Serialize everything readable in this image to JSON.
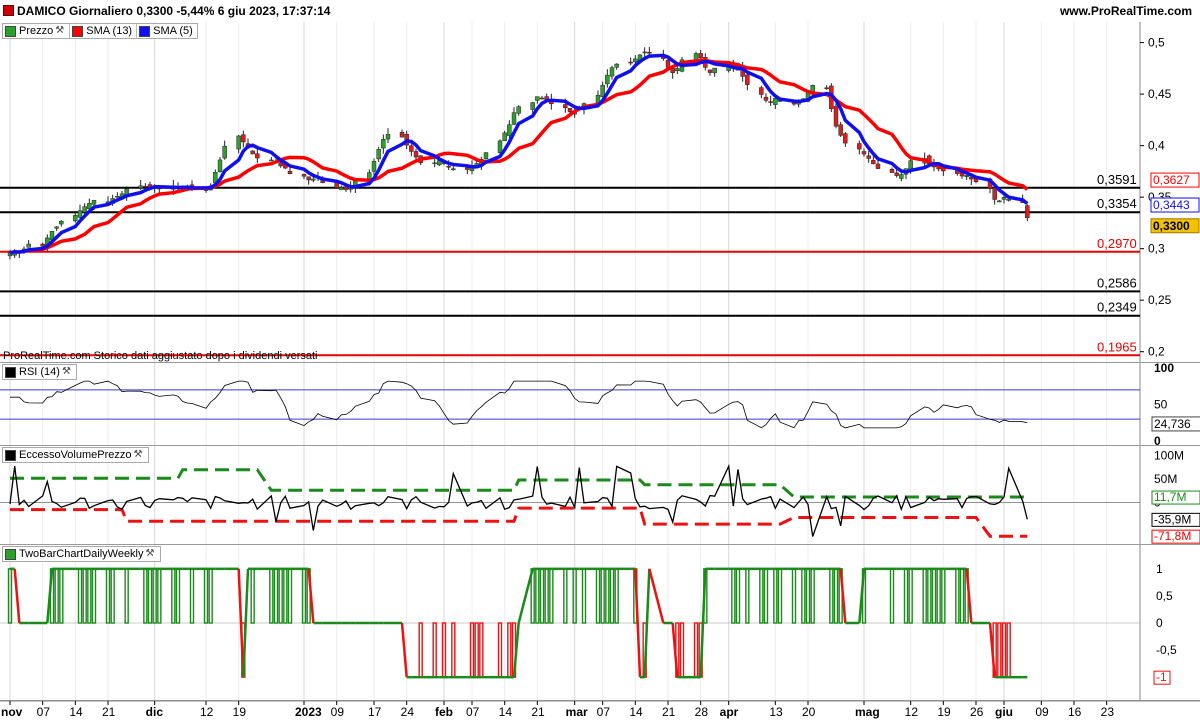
{
  "header": {
    "title": "DAMICO Giornaliero 0,3300 -5,44% 6 giu 2023, 17:37:14",
    "site": "www.ProRealTime.com"
  },
  "note": "ProRealTime.com Storico dati aggiustato dopo i dividendi versati",
  "legend": {
    "price": "Prezzo",
    "sma13": "SMA (13)",
    "sma5": "SMA (5)",
    "rsi": "RSI (14)",
    "evp": "EccessoVolumePrezzo",
    "tbc": "TwoBarChartDailyWeekly"
  },
  "colors": {
    "up": "#2e9e2e",
    "down": "#d42020",
    "sma13": "#ff0000",
    "sma5": "#1010ee",
    "last_price_badge": "#f2c200"
  },
  "chart_data": [
    {
      "type": "candlestick",
      "ylim": [
        0.19,
        0.52
      ],
      "y_ticks": [
        "0,5",
        "0,45",
        "0,4",
        "0,35",
        "0,3",
        "0,25",
        "0,2"
      ],
      "x_ticks": [
        "nov",
        "07",
        "14",
        "21",
        "dic",
        "12",
        "19",
        "2023",
        "09",
        "17",
        "24",
        "feb",
        "07",
        "14",
        "21",
        "mar",
        "07",
        "14",
        "21",
        "28",
        "apr",
        "13",
        "20",
        "mag",
        "12",
        "19",
        "26",
        "giu",
        "09",
        "16",
        "23"
      ],
      "x_range": [
        "2022-10-31",
        "2023-06-28"
      ],
      "last_date": "2023-06-06",
      "close_approx": [
        0.296,
        0.298,
        0.296,
        0.3,
        0.305,
        0.302,
        0.312,
        0.318,
        0.322,
        0.328,
        0.334,
        0.338,
        0.342,
        0.345,
        0.348,
        0.344,
        0.352,
        0.35,
        0.356,
        0.36,
        0.362,
        0.358,
        0.362,
        0.36,
        0.357,
        0.359,
        0.36,
        0.362,
        0.358,
        0.356,
        0.358,
        0.372,
        0.384,
        0.398,
        0.41,
        0.404,
        0.398,
        0.392,
        0.388,
        0.386,
        0.384,
        0.38,
        0.378,
        0.372,
        0.37,
        0.366,
        0.368,
        0.37,
        0.362,
        0.358,
        0.36,
        0.356,
        0.362,
        0.368,
        0.378,
        0.39,
        0.402,
        0.41,
        0.412,
        0.404,
        0.396,
        0.392,
        0.384,
        0.382,
        0.386,
        0.384,
        0.38,
        0.378,
        0.376,
        0.38,
        0.382,
        0.386,
        0.392,
        0.404,
        0.412,
        0.42,
        0.432,
        0.438,
        0.442,
        0.448,
        0.446,
        0.444,
        0.44,
        0.436,
        0.432,
        0.434,
        0.438,
        0.442,
        0.452,
        0.462,
        0.472,
        0.478,
        0.48,
        0.482,
        0.486,
        0.49,
        0.492,
        0.488,
        0.48,
        0.47,
        0.472,
        0.48,
        0.49,
        0.488,
        0.478,
        0.47,
        0.474,
        0.48,
        0.478,
        0.474,
        0.468,
        0.46,
        0.45,
        0.444,
        0.442,
        0.446,
        0.444,
        0.44,
        0.442,
        0.446,
        0.452,
        0.46,
        0.455,
        0.43,
        0.415,
        0.408,
        0.4,
        0.395,
        0.39,
        0.386,
        0.38,
        0.376,
        0.372,
        0.37,
        0.374,
        0.382,
        0.39,
        0.384,
        0.38,
        0.378,
        0.376,
        0.374,
        0.37,
        0.372,
        0.368,
        0.366,
        0.36,
        0.348,
        0.346,
        0.35,
        0.348,
        0.345,
        0.33
      ],
      "horizontal_levels": [
        {
          "value": 0.3591,
          "label": "0,3591",
          "color": "#000000"
        },
        {
          "value": 0.3354,
          "label": "0,3354",
          "color": "#000000"
        },
        {
          "value": 0.297,
          "label": "0,2970",
          "color": "#ee0000"
        },
        {
          "value": 0.2586,
          "label": "0,2586",
          "color": "#000000"
        },
        {
          "value": 0.2349,
          "label": "0,2349",
          "color": "#000000"
        },
        {
          "value": 0.1965,
          "label": "0,1965",
          "color": "#ee0000"
        }
      ],
      "badges": [
        {
          "value": 0.3627,
          "label": "0,3627",
          "color": "#ff0000",
          "style": "outline"
        },
        {
          "value": 0.3443,
          "label": "0,3443",
          "color": "#1010ee",
          "style": "outline"
        },
        {
          "value": 0.33,
          "label": "0,3300",
          "color": "#f2c200",
          "style": "fill"
        }
      ]
    },
    {
      "type": "line",
      "name": "RSI (14)",
      "ylim": [
        0,
        100
      ],
      "y_ticks": [
        "100",
        "50",
        "0"
      ],
      "levels": [
        70,
        30
      ],
      "last_value_label": "24,736",
      "last_value": 24.736
    },
    {
      "type": "line",
      "name": "EccessoVolumePrezzo",
      "ylim": [
        -80,
        110
      ],
      "y_ticks": [
        "100M",
        "50M",
        "0"
      ],
      "badges": [
        {
          "value": 11.7,
          "label": "11,7M",
          "color": "#1a8a1a"
        },
        {
          "value": -35.9,
          "label": "-35,9M",
          "color": "#000000"
        },
        {
          "value": -71.8,
          "label": "-71,8M",
          "color": "#ee0000"
        }
      ]
    },
    {
      "type": "step",
      "name": "TwoBarChartDailyWeekly",
      "ylim": [
        -1.2,
        1.2
      ],
      "y_ticks": [
        "1",
        "0,5",
        "0",
        "-0,5",
        "-1"
      ],
      "last_value_label": "-1"
    }
  ]
}
